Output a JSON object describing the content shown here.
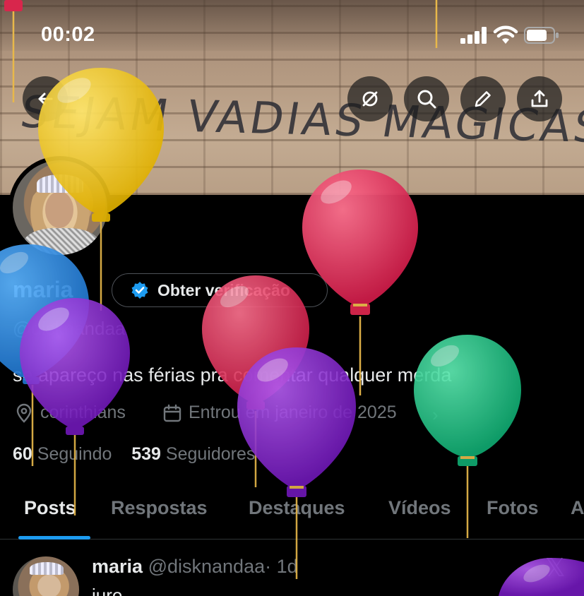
{
  "status_bar": {
    "time": "00:02"
  },
  "banner": {
    "graffiti_text": "SEJAM VADIAS MAGICAS"
  },
  "header": {
    "buttons": [
      "back-icon",
      "ai-icon",
      "search-icon",
      "edit-icon",
      "share-icon"
    ]
  },
  "profile": {
    "name": "maria",
    "verify_label": "Obter verificação",
    "handle": "@disknandaa",
    "bio": "se apareço nas férias pra comentar qualquer merda",
    "location": "corinthians",
    "joined": "Entrou em janeiro de 2025",
    "following_count": "60",
    "following_label": "Seguindo",
    "followers_count": "539",
    "followers_label": "Seguidores"
  },
  "tabs": [
    {
      "label": "Posts",
      "active": true
    },
    {
      "label": "Respostas",
      "active": false
    },
    {
      "label": "Destaques",
      "active": false
    },
    {
      "label": "Vídeos",
      "active": false
    },
    {
      "label": "Fotos",
      "active": false
    },
    {
      "label": "A",
      "active": false
    }
  ],
  "post": {
    "name": "maria",
    "handle": "@disknandaa",
    "time": "· 1d",
    "text": "juro"
  },
  "colors": {
    "accent": "#1d9bf0",
    "muted": "#71767b",
    "text": "#e7e9ea",
    "balloon_yellow": "#f2c418",
    "balloon_red": "#e23a5e",
    "balloon_purple": "#8b2fcf",
    "balloon_blue": "#2f8ee0",
    "balloon_green": "#22c88a"
  }
}
